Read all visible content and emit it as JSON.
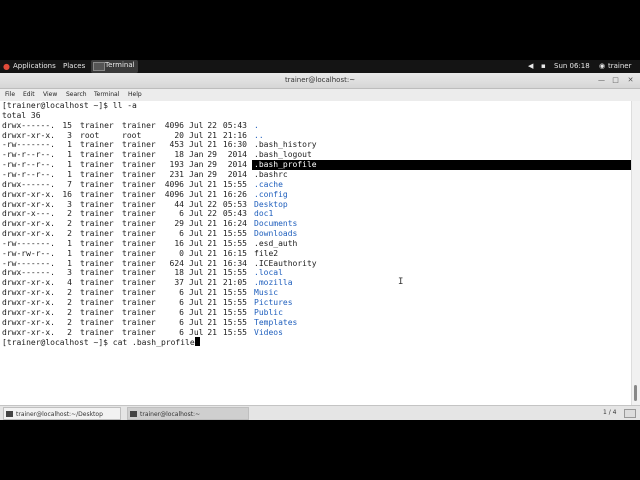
{
  "topbar": {
    "applications": "Applications",
    "places": "Places",
    "task_terminal": "Terminal",
    "clock": "Sun 06:18",
    "user": "trainer"
  },
  "window": {
    "title": "trainer@localhost:~"
  },
  "menu": [
    "File",
    "Edit",
    "View",
    "Search",
    "Terminal",
    "Help"
  ],
  "terminal": {
    "prompt1": "[trainer@localhost ~]$ ll -a",
    "total": "total 36",
    "listing": [
      {
        "perm": "drwx------.",
        "links": "15",
        "owner": "trainer",
        "group": "trainer",
        "size": "4096",
        "mon": "Jul",
        "day": "22",
        "time": "05:43",
        "name": ".",
        "dir": true
      },
      {
        "perm": "drwxr-xr-x.",
        "links": "3",
        "owner": "root",
        "group": "root",
        "size": "20",
        "mon": "Jul",
        "day": "21",
        "time": "21:16",
        "name": "..",
        "dir": true
      },
      {
        "perm": "-rw-------.",
        "links": "1",
        "owner": "trainer",
        "group": "trainer",
        "size": "453",
        "mon": "Jul",
        "day": "21",
        "time": "16:30",
        "name": ".bash_history",
        "dir": false
      },
      {
        "perm": "-rw-r--r--.",
        "links": "1",
        "owner": "trainer",
        "group": "trainer",
        "size": "18",
        "mon": "Jan",
        "day": "29",
        "time": "2014",
        "name": ".bash_logout",
        "dir": false
      },
      {
        "perm": "-rw-r--r--.",
        "links": "1",
        "owner": "trainer",
        "group": "trainer",
        "size": "193",
        "mon": "Jan",
        "day": "29",
        "time": "2014",
        "name": ".bash_profile",
        "dir": false,
        "highlight": true
      },
      {
        "perm": "-rw-r--r--.",
        "links": "1",
        "owner": "trainer",
        "group": "trainer",
        "size": "231",
        "mon": "Jan",
        "day": "29",
        "time": "2014",
        "name": ".bashrc",
        "dir": false
      },
      {
        "perm": "drwx------.",
        "links": "7",
        "owner": "trainer",
        "group": "trainer",
        "size": "4096",
        "mon": "Jul",
        "day": "21",
        "time": "15:55",
        "name": ".cache",
        "dir": true
      },
      {
        "perm": "drwxr-xr-x.",
        "links": "16",
        "owner": "trainer",
        "group": "trainer",
        "size": "4096",
        "mon": "Jul",
        "day": "21",
        "time": "16:26",
        "name": ".config",
        "dir": true
      },
      {
        "perm": "drwxr-xr-x.",
        "links": "3",
        "owner": "trainer",
        "group": "trainer",
        "size": "44",
        "mon": "Jul",
        "day": "22",
        "time": "05:53",
        "name": "Desktop",
        "dir": true
      },
      {
        "perm": "drwxr-x---.",
        "links": "2",
        "owner": "trainer",
        "group": "trainer",
        "size": "6",
        "mon": "Jul",
        "day": "22",
        "time": "05:43",
        "name": "doc1",
        "dir": true
      },
      {
        "perm": "drwxr-xr-x.",
        "links": "2",
        "owner": "trainer",
        "group": "trainer",
        "size": "29",
        "mon": "Jul",
        "day": "21",
        "time": "16:24",
        "name": "Documents",
        "dir": true
      },
      {
        "perm": "drwxr-xr-x.",
        "links": "2",
        "owner": "trainer",
        "group": "trainer",
        "size": "6",
        "mon": "Jul",
        "day": "21",
        "time": "15:55",
        "name": "Downloads",
        "dir": true
      },
      {
        "perm": "-rw-------.",
        "links": "1",
        "owner": "trainer",
        "group": "trainer",
        "size": "16",
        "mon": "Jul",
        "day": "21",
        "time": "15:55",
        "name": ".esd_auth",
        "dir": false
      },
      {
        "perm": "-rw-rw-r--.",
        "links": "1",
        "owner": "trainer",
        "group": "trainer",
        "size": "0",
        "mon": "Jul",
        "day": "21",
        "time": "16:15",
        "name": "file2",
        "dir": false
      },
      {
        "perm": "-rw-------.",
        "links": "1",
        "owner": "trainer",
        "group": "trainer",
        "size": "624",
        "mon": "Jul",
        "day": "21",
        "time": "16:34",
        "name": ".ICEauthority",
        "dir": false
      },
      {
        "perm": "drwx------.",
        "links": "3",
        "owner": "trainer",
        "group": "trainer",
        "size": "18",
        "mon": "Jul",
        "day": "21",
        "time": "15:55",
        "name": ".local",
        "dir": true
      },
      {
        "perm": "drwxr-xr-x.",
        "links": "4",
        "owner": "trainer",
        "group": "trainer",
        "size": "37",
        "mon": "Jul",
        "day": "21",
        "time": "21:05",
        "name": ".mozilla",
        "dir": true
      },
      {
        "perm": "drwxr-xr-x.",
        "links": "2",
        "owner": "trainer",
        "group": "trainer",
        "size": "6",
        "mon": "Jul",
        "day": "21",
        "time": "15:55",
        "name": "Music",
        "dir": true
      },
      {
        "perm": "drwxr-xr-x.",
        "links": "2",
        "owner": "trainer",
        "group": "trainer",
        "size": "6",
        "mon": "Jul",
        "day": "21",
        "time": "15:55",
        "name": "Pictures",
        "dir": true
      },
      {
        "perm": "drwxr-xr-x.",
        "links": "2",
        "owner": "trainer",
        "group": "trainer",
        "size": "6",
        "mon": "Jul",
        "day": "21",
        "time": "15:55",
        "name": "Public",
        "dir": true
      },
      {
        "perm": "drwxr-xr-x.",
        "links": "2",
        "owner": "trainer",
        "group": "trainer",
        "size": "6",
        "mon": "Jul",
        "day": "21",
        "time": "15:55",
        "name": "Templates",
        "dir": true
      },
      {
        "perm": "drwxr-xr-x.",
        "links": "2",
        "owner": "trainer",
        "group": "trainer",
        "size": "6",
        "mon": "Jul",
        "day": "21",
        "time": "15:55",
        "name": "Videos",
        "dir": true
      }
    ],
    "prompt2": "[trainer@localhost ~]$ cat .bash_profile"
  },
  "taskbar": {
    "tasks": [
      "trainer@localhost:~/Desktop",
      "trainer@localhost:~"
    ],
    "workspace": "1 / 4"
  },
  "colors": {
    "directory": "#1f5fbd",
    "topbar": "#141414"
  }
}
